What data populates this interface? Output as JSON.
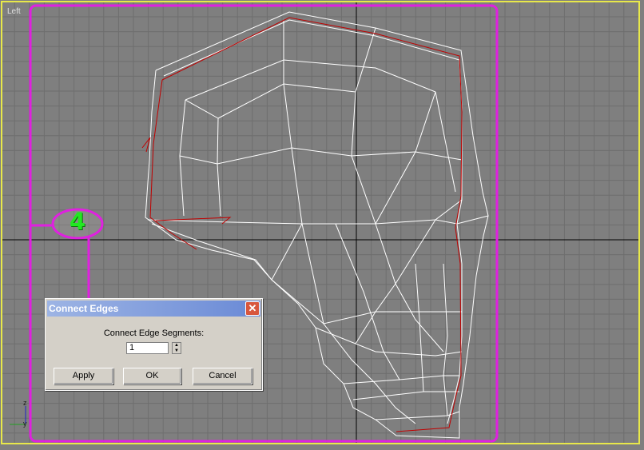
{
  "viewport": {
    "label": "Left",
    "frame_color": "#e8e84a",
    "grid_color": "#6e6e6e",
    "background_color": "#7f7f7f",
    "wire_color": "#ffffff",
    "selected_edge_color": "#c00000"
  },
  "axis_gizmo": {
    "z_label": "z",
    "y_label": "y"
  },
  "annotation": {
    "callout_number": "4",
    "callout_color": "#e020e0",
    "number_color": "#22e822"
  },
  "dialog": {
    "title": "Connect Edges",
    "close_icon": "close-icon",
    "segments_label": "Connect Edge Segments:",
    "segments_value": "1",
    "apply_label": "Apply",
    "ok_label": "OK",
    "cancel_label": "Cancel"
  }
}
